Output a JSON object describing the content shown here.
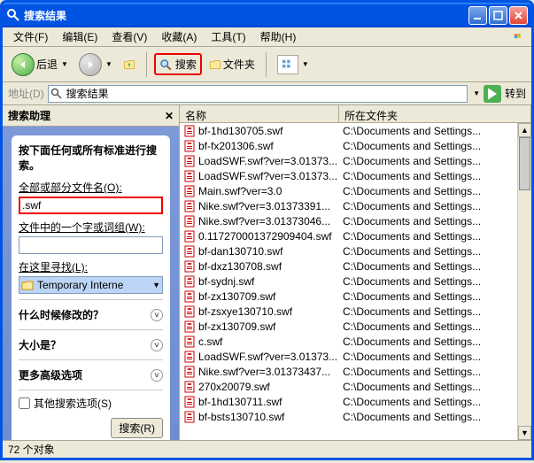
{
  "window": {
    "title": "搜索结果"
  },
  "menu": {
    "file": "文件(F)",
    "edit": "编辑(E)",
    "view": "查看(V)",
    "favorites": "收藏(A)",
    "tools": "工具(T)",
    "help": "帮助(H)"
  },
  "toolbar": {
    "back": "后退",
    "search": "搜索",
    "folders": "文件夹"
  },
  "address": {
    "label": "地址(D)",
    "value": "搜索结果",
    "go": "转到"
  },
  "sidebar": {
    "title": "搜索助理",
    "heading": "按下面任何或所有标准进行搜索。",
    "filename_label": "全部或部分文件名(O):",
    "filename_value": ".swf",
    "word_label": "文件中的一个字或词组(W):",
    "lookin_label": "在这里寻找(L):",
    "lookin_value": "Temporary Interne",
    "when": "什么时候修改的？",
    "size": "大小是？",
    "more": "更多高级选项",
    "other": "其他搜索选项(S)",
    "search_btn": "搜索(R)"
  },
  "columns": {
    "name": "名称",
    "folder": "所在文件夹"
  },
  "files": [
    {
      "n": "bf-1hd130705.swf",
      "p": "C:\\Documents and Settings..."
    },
    {
      "n": "bf-fx201306.swf",
      "p": "C:\\Documents and Settings..."
    },
    {
      "n": "LoadSWF.swf?ver=3.01373...",
      "p": "C:\\Documents and Settings..."
    },
    {
      "n": "LoadSWF.swf?ver=3.01373...",
      "p": "C:\\Documents and Settings..."
    },
    {
      "n": "Main.swf?ver=3.0",
      "p": "C:\\Documents and Settings..."
    },
    {
      "n": "Nike.swf?ver=3.01373391...",
      "p": "C:\\Documents and Settings..."
    },
    {
      "n": "Nike.swf?ver=3.01373046...",
      "p": "C:\\Documents and Settings..."
    },
    {
      "n": "0.1172700013729094­04.swf",
      "p": "C:\\Documents and Settings..."
    },
    {
      "n": "bf-dan130710.swf",
      "p": "C:\\Documents and Settings..."
    },
    {
      "n": "bf-dxz130708.swf",
      "p": "C:\\Documents and Settings..."
    },
    {
      "n": "bf-sydnj.swf",
      "p": "C:\\Documents and Settings..."
    },
    {
      "n": "bf-zx130709.swf",
      "p": "C:\\Documents and Settings..."
    },
    {
      "n": "bf-zsxye130710.swf",
      "p": "C:\\Documents and Settings..."
    },
    {
      "n": "bf-zx130709.swf",
      "p": "C:\\Documents and Settings..."
    },
    {
      "n": "c.swf",
      "p": "C:\\Documents and Settings..."
    },
    {
      "n": "LoadSWF.swf?ver=3.01373...",
      "p": "C:\\Documents and Settings..."
    },
    {
      "n": "Nike.swf?ver=3.01373437...",
      "p": "C:\\Documents and Settings..."
    },
    {
      "n": "270x20079.swf",
      "p": "C:\\Documents and Settings..."
    },
    {
      "n": "bf-1hd130711.swf",
      "p": "C:\\Documents and Settings..."
    },
    {
      "n": "bf-bsts130710.swf",
      "p": "C:\\Documents and Settings..."
    }
  ],
  "status": "72 个对象"
}
